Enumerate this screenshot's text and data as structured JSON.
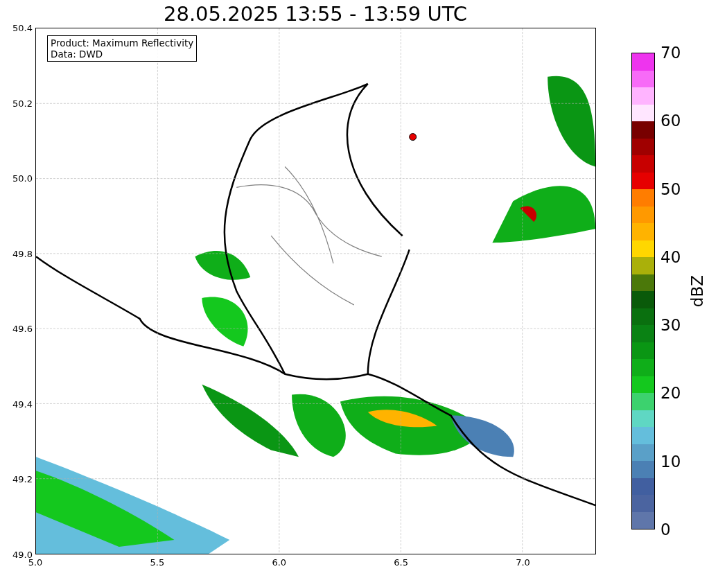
{
  "plot": {
    "title": "28.05.2025 13:55 - 13:59 UTC",
    "legend": [
      "Product: Maximum Reflectivity",
      "Data: DWD"
    ],
    "xticks": [
      "5.0",
      "5.5",
      "6.0",
      "6.5",
      "7.0"
    ],
    "yticks": [
      "50.4",
      "50.2",
      "50.0",
      "49.8",
      "49.6",
      "49.4",
      "49.2",
      "49.0"
    ]
  },
  "colorbar": {
    "label": "dBZ",
    "ticks": [
      "70",
      "60",
      "50",
      "40",
      "30",
      "20",
      "10",
      "0"
    ],
    "bands": [
      {
        "color": "#ee34ee"
      },
      {
        "color": "#f76bf7"
      },
      {
        "color": "#ffb4ff"
      },
      {
        "color": "#ffe6ff"
      },
      {
        "color": "#780000"
      },
      {
        "color": "#a00000"
      },
      {
        "color": "#c80000"
      },
      {
        "color": "#e60000"
      },
      {
        "color": "#ff7d00"
      },
      {
        "color": "#ff9900"
      },
      {
        "color": "#ffb300"
      },
      {
        "color": "#ffd700"
      },
      {
        "color": "#aab00a"
      },
      {
        "color": "#4b780a"
      },
      {
        "color": "#0a5a0a"
      },
      {
        "color": "#0a700f"
      },
      {
        "color": "#0a8214"
      },
      {
        "color": "#0a9614"
      },
      {
        "color": "#0fae19"
      },
      {
        "color": "#14c81e"
      },
      {
        "color": "#3cd26e"
      },
      {
        "color": "#5fd7c3"
      },
      {
        "color": "#64bedc"
      },
      {
        "color": "#5aa0c8"
      },
      {
        "color": "#4b80b4"
      },
      {
        "color": "#415fa0"
      },
      {
        "color": "#4b64a0"
      },
      {
        "color": "#5f76aa"
      }
    ]
  }
}
